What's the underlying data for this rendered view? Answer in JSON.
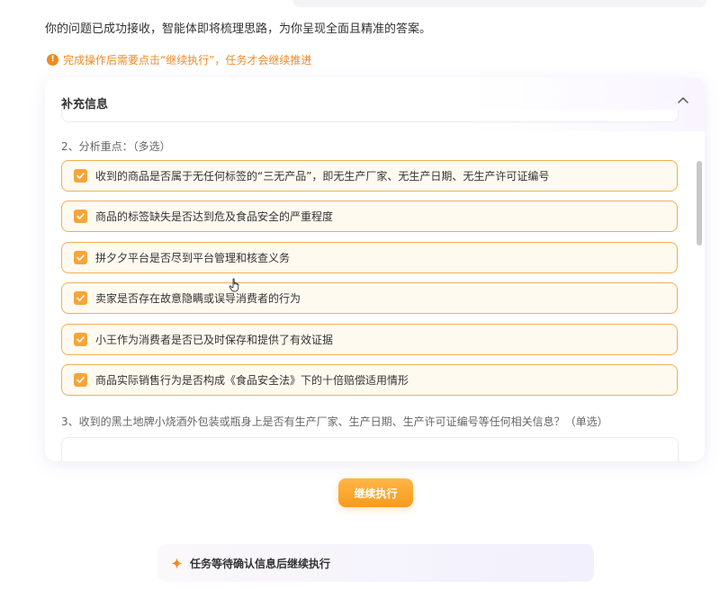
{
  "intro_text": "你的问题已成功接收，智能体即将梳理思路，为你呈现全面且精准的答案。",
  "notice": {
    "icon": "warning-circle-icon",
    "text": "完成操作后需要点击“继续执行”，任务才会继续推进",
    "color": "#ef8a2a"
  },
  "panel": {
    "title": "补充信息",
    "collapse_icon": "chevron-up-icon",
    "question2": {
      "label": "2、分析重点：（多选）",
      "options": [
        {
          "label": "收到的商品是否属于无任何标签的“三无产品”，即无生产厂家、无生产日期、无生产许可证编号",
          "checked": true
        },
        {
          "label": "商品的标签缺失是否达到危及食品安全的严重程度",
          "checked": true
        },
        {
          "label": "拼夕夕平台是否尽到平台管理和核查义务",
          "checked": true
        },
        {
          "label": "卖家是否存在故意隐瞒或误导消费者的行为",
          "checked": true
        },
        {
          "label": "小王作为消费者是否已及时保存和提供了有效证据",
          "checked": true
        },
        {
          "label": "商品实际销售行为是否构成《食品安全法》下的十倍赔偿适用情形",
          "checked": true
        }
      ]
    },
    "question3": {
      "label": "3、收到的黑土地牌小烧酒外包装或瓶身上是否有生产厂家、生产日期、生产许可证编号等任何相关信息？（单选）"
    }
  },
  "continue_button": {
    "label": "继续执行",
    "color": "#f79b1c"
  },
  "status": {
    "icon": "sparkle-icon",
    "text": "任务等待确认信息后继续执行"
  },
  "colors": {
    "accent": "#f5a53a",
    "option_border": "#f0b056",
    "option_bg": "#fffaf0"
  }
}
